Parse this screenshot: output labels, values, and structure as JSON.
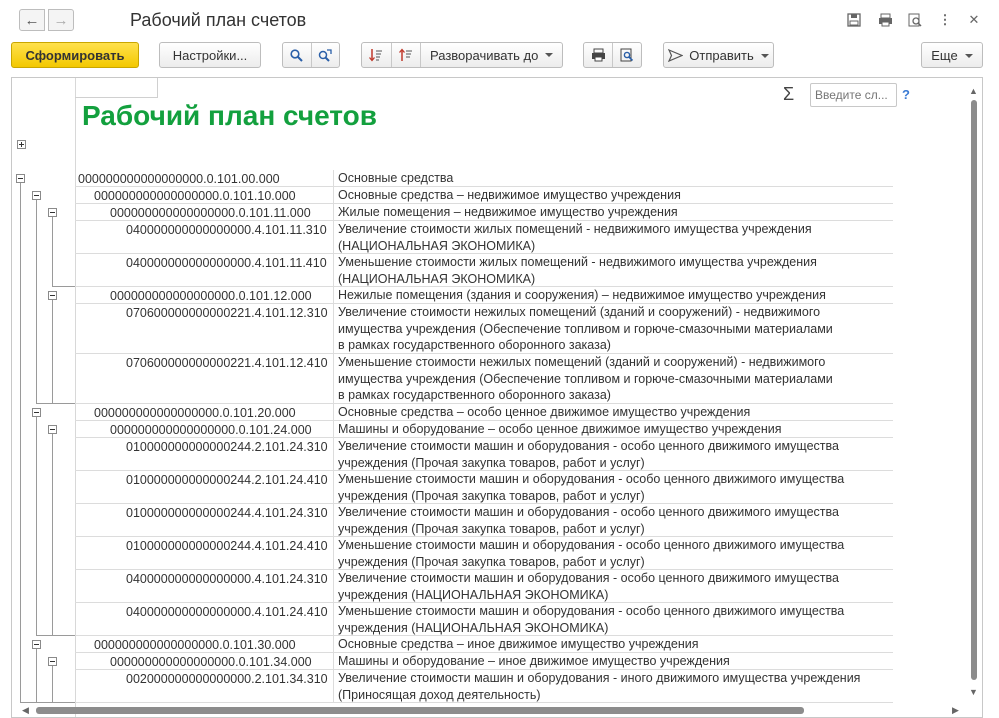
{
  "window": {
    "title": "Рабочий план счетов",
    "icons": [
      "save-icon",
      "print-icon",
      "preview-icon",
      "more-icon",
      "close-icon"
    ]
  },
  "toolbar": {
    "generate_label": "Сформировать",
    "settings_label": "Настройки...",
    "expand_label": "Разворачивать до",
    "send_label": "Отправить",
    "sigma": "Σ",
    "search_placeholder": "Введите сл...",
    "help_label": "?",
    "more_label": "Еще"
  },
  "report": {
    "title": "Рабочий план счетов",
    "rows": [
      {
        "code": "000000000000000000.0.101.00.000",
        "name": "Основные средства",
        "level": 0
      },
      {
        "code": "000000000000000000.0.101.10.000",
        "name": "Основные средства – недвижимое имущество учреждения",
        "level": 1
      },
      {
        "code": "000000000000000000.0.101.11.000",
        "name": "Жилые помещения – недвижимое имущество учреждения",
        "level": 2
      },
      {
        "code": "040000000000000000.4.101.11.310",
        "name": "Увеличение стоимости жилых помещений - недвижимого имущества учреждения\n(НАЦИОНАЛЬНАЯ ЭКОНОМИКА)",
        "level": 3
      },
      {
        "code": "040000000000000000.4.101.11.410",
        "name": "Уменьшение стоимости жилых помещений - недвижимого имущества учреждения\n(НАЦИОНАЛЬНАЯ ЭКОНОМИКА)",
        "level": 3
      },
      {
        "code": "000000000000000000.0.101.12.000",
        "name": "Нежилые помещения (здания и сооружения) – недвижимое имущество учреждения",
        "level": 2
      },
      {
        "code": "070600000000000221.4.101.12.310",
        "name": "Увеличение стоимости нежилых помещений (зданий и сооружений) -  недвижимого\nимущества учреждения (Обеспечение топливом и горюче-смазочными материалами\nв рамках государственного оборонного заказа)",
        "level": 3
      },
      {
        "code": "070600000000000221.4.101.12.410",
        "name": "Уменьшение стоимости нежилых помещений  (зданий и сооружений) - недвижимого\nимущества учреждения (Обеспечение топливом и горюче-смазочными материалами\nв рамках государственного оборонного заказа)",
        "level": 3
      },
      {
        "code": "000000000000000000.0.101.20.000",
        "name": "Основные средства – особо ценное движимое имущество учреждения",
        "level": 1
      },
      {
        "code": "000000000000000000.0.101.24.000",
        "name": "Машины и оборудование – особо ценное движимое имущество учреждения",
        "level": 2
      },
      {
        "code": "010000000000000244.2.101.24.310",
        "name": "Увеличение стоимости машин и оборудования - особо ценного движимого имущества\nучреждения (Прочая закупка товаров, работ и услуг)",
        "level": 3
      },
      {
        "code": "010000000000000244.2.101.24.410",
        "name": "Уменьшение стоимости машин и оборудования - особо ценного движимого имущества\nучреждения (Прочая закупка товаров, работ и услуг)",
        "level": 3
      },
      {
        "code": "010000000000000244.4.101.24.310",
        "name": "Увеличение стоимости машин и оборудования - особо ценного движимого имущества\nучреждения (Прочая закупка товаров, работ и услуг)",
        "level": 3
      },
      {
        "code": "010000000000000244.4.101.24.410",
        "name": "Уменьшение стоимости машин и оборудования - особо ценного движимого имущества\nучреждения (Прочая закупка товаров, работ и услуг)",
        "level": 3
      },
      {
        "code": "040000000000000000.4.101.24.310",
        "name": "Увеличение стоимости машин и оборудования - особо ценного движимого имущества\nучреждения (НАЦИОНАЛЬНАЯ ЭКОНОМИКА)",
        "level": 3
      },
      {
        "code": "040000000000000000.4.101.24.410",
        "name": "Уменьшение стоимости машин и оборудования - особо ценного движимого имущества\nучреждения (НАЦИОНАЛЬНАЯ ЭКОНОМИКА)",
        "level": 3
      },
      {
        "code": "000000000000000000.0.101.30.000",
        "name": "Основные средства –  иное движимое имущество учреждения",
        "level": 1
      },
      {
        "code": "000000000000000000.0.101.34.000",
        "name": "Машины и оборудование – иное движимое имущество учреждения",
        "level": 2
      },
      {
        "code": "002000000000000000.2.101.34.310",
        "name": "Увеличение стоимости машин и оборудования -  иного движимого имущества учреждения\n(Приносящая доход деятельность)",
        "level": 3
      }
    ]
  }
}
